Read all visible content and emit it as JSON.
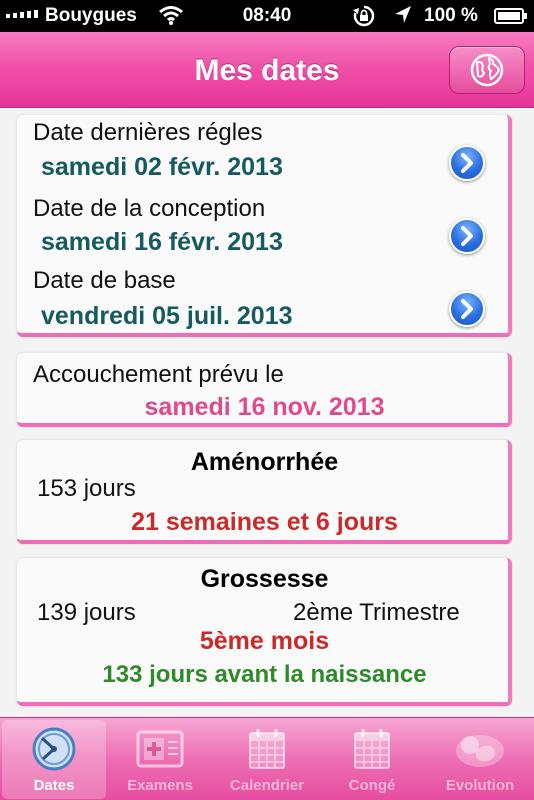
{
  "status_bar": {
    "carrier": "Bouygues",
    "time": "08:40",
    "battery": "100 %"
  },
  "nav": {
    "title": "Mes dates",
    "globe_icon": "globe-icon"
  },
  "dates_card": {
    "last_period_label": "Date dernières régles",
    "last_period_value": "samedi 02 févr. 2013",
    "conception_label": "Date de la conception",
    "conception_value": "samedi 16 févr. 2013",
    "base_label": "Date de base",
    "base_value": "vendredi 05 juil. 2013"
  },
  "due_card": {
    "label": "Accouchement prévu le",
    "value": "samedi 16 nov. 2013"
  },
  "amenorrhea_card": {
    "heading": "Aménorrhée",
    "days": "153 jours",
    "weeks": "21 semaines et 6 jours"
  },
  "pregnancy_card": {
    "heading": "Grossesse",
    "days": "139 jours",
    "trimester": "2ème Trimestre",
    "month": "5ème mois",
    "remaining": "133 jours avant la naissance"
  },
  "tabs": [
    {
      "label": "Dates",
      "icon": "clock-icon",
      "active": true
    },
    {
      "label": "Examens",
      "icon": "medical-kit-icon",
      "active": false
    },
    {
      "label": "Calendrier",
      "icon": "calendar-icon",
      "active": false
    },
    {
      "label": "Congé",
      "icon": "calendar-icon",
      "active": false
    },
    {
      "label": "Evolution",
      "icon": "fetus-icon",
      "active": false
    }
  ],
  "colors": {
    "brand_pink": "#ef4ea6",
    "teal_value": "#155a5e",
    "pink_value": "#e04a8a",
    "red_value": "#cc2a2a",
    "green_value": "#2f8a2a"
  }
}
